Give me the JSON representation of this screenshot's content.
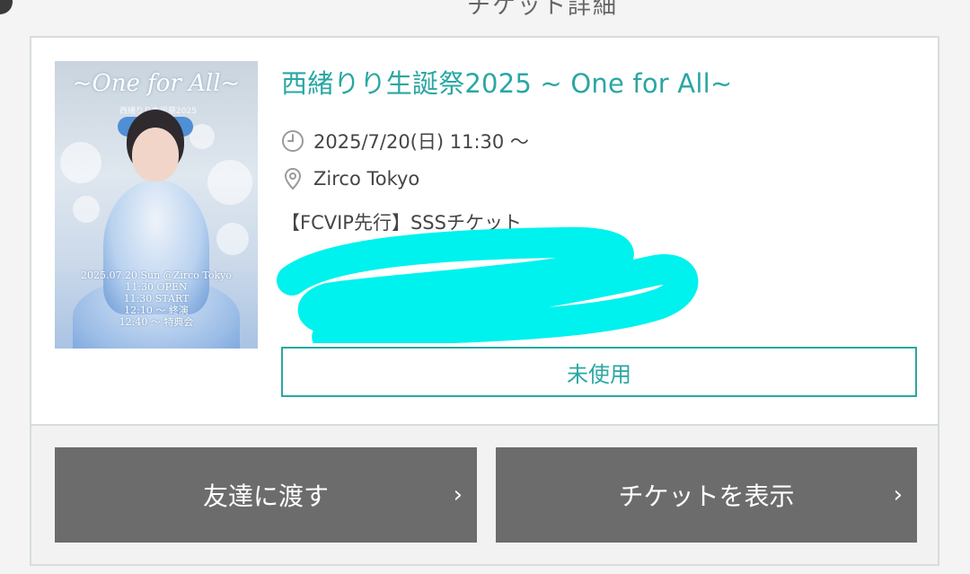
{
  "header": {
    "partial_title": "チケット詳細"
  },
  "event": {
    "title": "西緒りり生誕祭2025 ~ One for All~",
    "date": "2025/7/20(日) 11:30 ～",
    "venue": "Zirco Tokyo",
    "ticket_type": "【FCVIP先行】SSSチケット",
    "status": "未使用"
  },
  "poster": {
    "title": "~One for All~",
    "subtitle": "西緒りり生誕祭2025",
    "info_lines": [
      "2025.07.20.Sun @Zirco Tokyo",
      "11:30 OPEN",
      "11:30 START",
      "12:10 〜 終演",
      "12:40 〜 特典会"
    ]
  },
  "actions": {
    "transfer_label": "友達に渡す",
    "show_label": "チケットを表示",
    "chevron": "›"
  },
  "colors": {
    "accent": "#2aa7a3",
    "button_bg": "#6c6c6c",
    "redaction": "#00f2ee"
  },
  "icons": {
    "date": "clock-icon",
    "venue": "map-pin-icon",
    "chevron": "chevron-right-icon"
  }
}
